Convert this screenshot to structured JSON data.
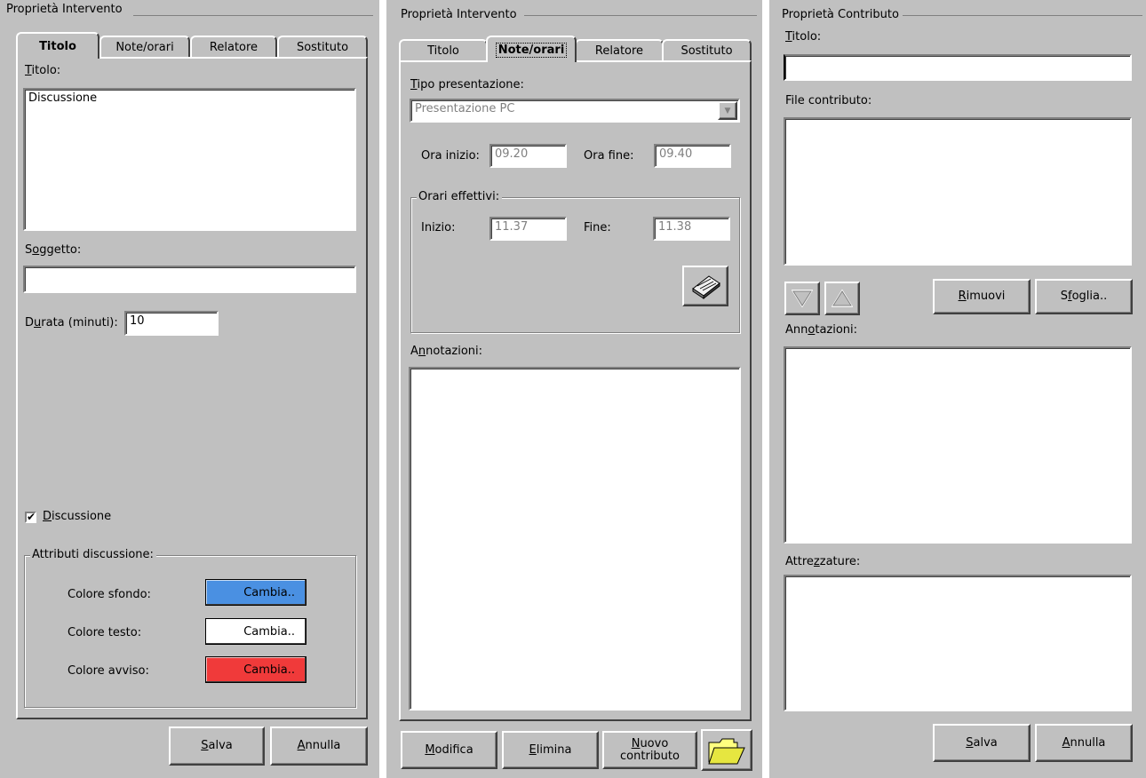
{
  "left": {
    "legend": "Proprietà Intervento",
    "tabs": [
      "Titolo",
      "Note/orari",
      "Relatore",
      "Sostituto"
    ],
    "titolo_label_u": "T",
    "titolo_label_rest": "itolo:",
    "titolo_value": "Discussione",
    "soggetto_label_pre": "S",
    "soggetto_label_u": "o",
    "soggetto_label_rest": "ggetto:",
    "soggetto_value": "",
    "durata_label_pre": "D",
    "durata_label_u": "u",
    "durata_label_rest": "rata (minuti):",
    "durata_value": "10",
    "check_mark": "✔",
    "discussione_check_u": "D",
    "discussione_check_rest": "iscussione",
    "attributi_legend": "Attributi discussione:",
    "colors": [
      {
        "label": "Colore sfondo:",
        "button": "Cambia..",
        "color": "#4a90e2",
        "text_color": "#000000"
      },
      {
        "label": "Colore testo:",
        "button": "Cambia..",
        "color": "#ffffff",
        "text_color": "#000000"
      },
      {
        "label": "Colore avviso:",
        "button": "Cambia..",
        "color": "#f03a3a",
        "text_color": "#000000"
      }
    ],
    "salva_u": "S",
    "salva_rest": "alva",
    "annulla_u": "A",
    "annulla_rest": "nnulla"
  },
  "middle": {
    "legend": "Proprietà Intervento",
    "tabs": [
      "Titolo",
      "Note/orari",
      "Relatore",
      "Sostituto"
    ],
    "tipo_label_u": "T",
    "tipo_label_rest": "ipo presentazione:",
    "tipo_value": "Presentazione PC",
    "dropdown_arrow": "▼",
    "ora_inizio_label": "Ora inizio:",
    "ora_inizio_value": "09.20",
    "ora_fine_label": "Ora fine:",
    "ora_fine_value": "09.40",
    "effettivi_legend": "Orari effettivi:",
    "inizio_label": "Inizio:",
    "inizio_value": "11.37",
    "fine_label": "Fine:",
    "fine_value": "11.38",
    "annotazioni_pre": "A",
    "annotazioni_u": "n",
    "annotazioni_rest": "notazioni:",
    "modifica_u": "M",
    "modifica_rest": "odifica",
    "elimina_u": "E",
    "elimina_rest": "limina",
    "nuovo_u": "N",
    "nuovo_rest": "uovo",
    "nuovo_line2": "contributo"
  },
  "right": {
    "legend": "Proprietà Contributo",
    "titolo_label_u": "T",
    "titolo_label_rest": "itolo:",
    "titolo_value": "",
    "file_label": "File contributo:",
    "rimuovi_u": "R",
    "rimuovi_rest": "imuovi",
    "sfoglia_pre": "S",
    "sfoglia_u": "f",
    "sfoglia_rest": "oglia..",
    "annotazioni_pre": "Ann",
    "annotazioni_u": "o",
    "annotazioni_rest": "tazioni:",
    "attrezzature_pre": "Attre",
    "attrezzature_u": "z",
    "attrezzature_rest": "zature:",
    "salva_u": "S",
    "salva_rest": "alva",
    "annulla_u": "A",
    "annulla_rest": "nnulla"
  }
}
